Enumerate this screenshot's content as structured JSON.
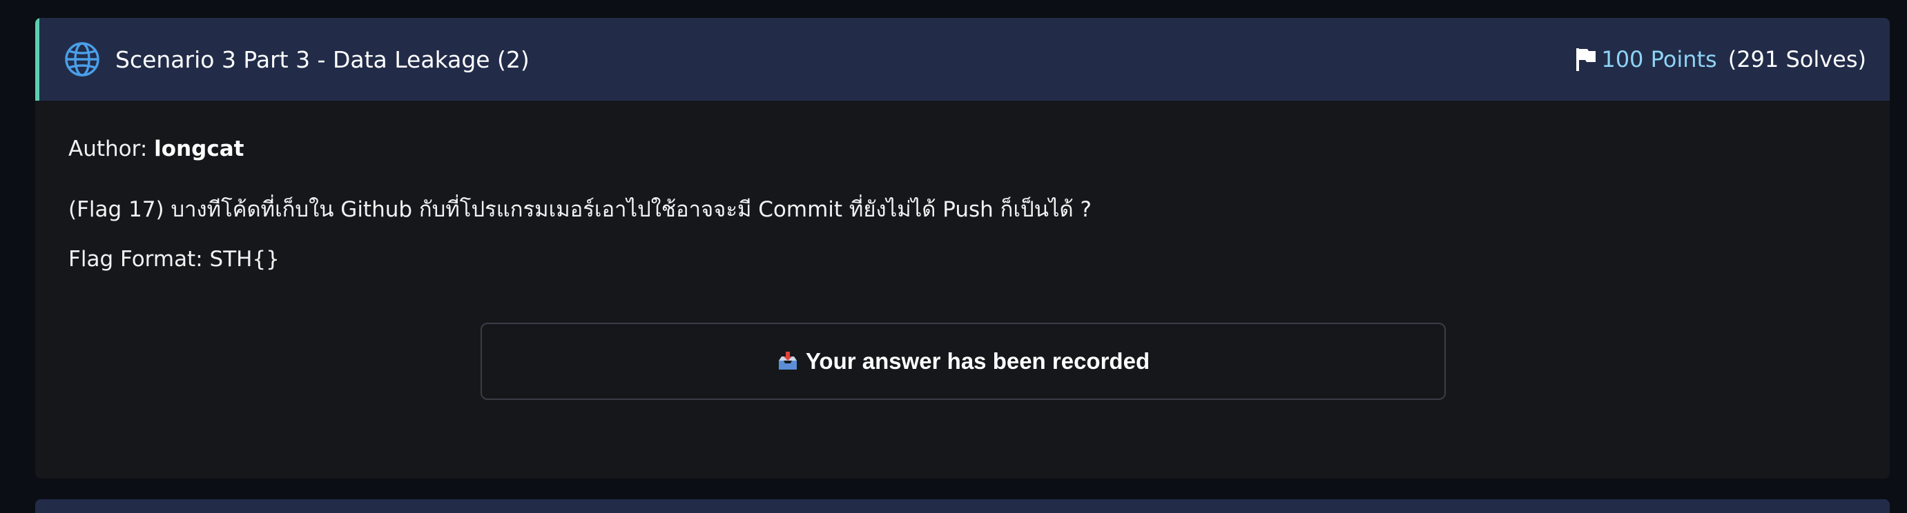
{
  "challenge": {
    "title": "Scenario 3 Part 3 - Data Leakage (2)",
    "points": "100 Points",
    "solves": "(291 Solves)",
    "author_label": "Author:",
    "author_name": "longcat",
    "description": "(Flag 17) บางทีโค้ดที่เก็บใน Github กับที่โปรแกรมเมอร์เอาไปใช้อาจจะมี Commit ที่ยังไม่ได้ Push ก็เป็นได้ ?",
    "flag_format": "Flag Format: STH{}",
    "status_message": "Your answer has been recorded"
  },
  "icons": {
    "category": "globe-icon",
    "points": "flag-icon",
    "status": "inbox-tray-icon"
  },
  "colors": {
    "page_background": "#0b0e14",
    "card_background": "#16171b",
    "header_background": "#222c49",
    "header_accent": "#5dcfb0",
    "points_color": "#8fd3f4",
    "globe_color": "#4a9fe8"
  }
}
